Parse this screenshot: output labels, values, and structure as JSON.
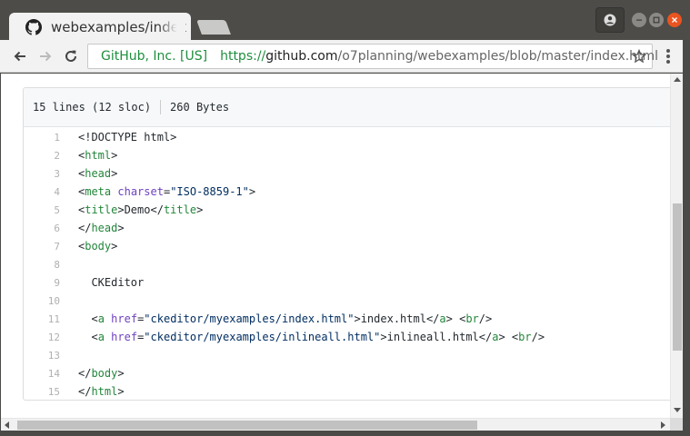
{
  "tab": {
    "title": "webexamples/index.html",
    "favicon": "github-icon"
  },
  "toolbar": {
    "site_identity": "GitHub, Inc. [US]",
    "url_scheme": "https://",
    "url_host": "github.com",
    "url_path": "/o7planning/webexamples/blob/master/index.html"
  },
  "file": {
    "lines_info": "15 lines (12 sloc)",
    "size": "260 Bytes"
  },
  "code_lines": [
    {
      "n": "1",
      "tokens": [
        [
          "plain",
          "<!DOCTYPE html>"
        ]
      ]
    },
    {
      "n": "2",
      "tokens": [
        [
          "plain",
          "<"
        ],
        [
          "tag",
          "html"
        ],
        [
          "plain",
          ">"
        ]
      ]
    },
    {
      "n": "3",
      "tokens": [
        [
          "plain",
          "<"
        ],
        [
          "tag",
          "head"
        ],
        [
          "plain",
          ">"
        ]
      ]
    },
    {
      "n": "4",
      "tokens": [
        [
          "plain",
          "<"
        ],
        [
          "tag",
          "meta"
        ],
        [
          "plain",
          " "
        ],
        [
          "attr",
          "charset"
        ],
        [
          "plain",
          "="
        ],
        [
          "str",
          "\"ISO-8859-1\""
        ],
        [
          "plain",
          ">"
        ]
      ]
    },
    {
      "n": "5",
      "tokens": [
        [
          "plain",
          "<"
        ],
        [
          "tag",
          "title"
        ],
        [
          "plain",
          ">Demo</"
        ],
        [
          "tag",
          "title"
        ],
        [
          "plain",
          ">"
        ]
      ]
    },
    {
      "n": "6",
      "tokens": [
        [
          "plain",
          "</"
        ],
        [
          "tag",
          "head"
        ],
        [
          "plain",
          ">"
        ]
      ]
    },
    {
      "n": "7",
      "tokens": [
        [
          "plain",
          "<"
        ],
        [
          "tag",
          "body"
        ],
        [
          "plain",
          ">"
        ]
      ]
    },
    {
      "n": "8",
      "tokens": []
    },
    {
      "n": "9",
      "tokens": [
        [
          "plain",
          "  CKEditor"
        ]
      ]
    },
    {
      "n": "10",
      "tokens": []
    },
    {
      "n": "11",
      "tokens": [
        [
          "plain",
          "  <"
        ],
        [
          "tag",
          "a"
        ],
        [
          "plain",
          " "
        ],
        [
          "attr",
          "href"
        ],
        [
          "plain",
          "="
        ],
        [
          "str",
          "\"ckeditor/myexamples/index.html\""
        ],
        [
          "plain",
          ">index.html</"
        ],
        [
          "tag",
          "a"
        ],
        [
          "plain",
          "> <"
        ],
        [
          "tag",
          "br"
        ],
        [
          "plain",
          "/>"
        ]
      ]
    },
    {
      "n": "12",
      "tokens": [
        [
          "plain",
          "  <"
        ],
        [
          "tag",
          "a"
        ],
        [
          "plain",
          " "
        ],
        [
          "attr",
          "href"
        ],
        [
          "plain",
          "="
        ],
        [
          "str",
          "\"ckeditor/myexamples/inlineall.html\""
        ],
        [
          "plain",
          ">inlineall.html</"
        ],
        [
          "tag",
          "a"
        ],
        [
          "plain",
          "> <"
        ],
        [
          "tag",
          "br"
        ],
        [
          "plain",
          "/>"
        ]
      ]
    },
    {
      "n": "13",
      "tokens": []
    },
    {
      "n": "14",
      "tokens": [
        [
          "plain",
          "</"
        ],
        [
          "tag",
          "body"
        ],
        [
          "plain",
          ">"
        ]
      ]
    },
    {
      "n": "15",
      "tokens": [
        [
          "plain",
          "</"
        ],
        [
          "tag",
          "html"
        ],
        [
          "plain",
          ">"
        ]
      ]
    }
  ],
  "colors": {
    "accent": "#e95420",
    "secure": "#1e8e3e",
    "tag": "#22863a",
    "attr": "#6f42c1",
    "string": "#032f62"
  }
}
